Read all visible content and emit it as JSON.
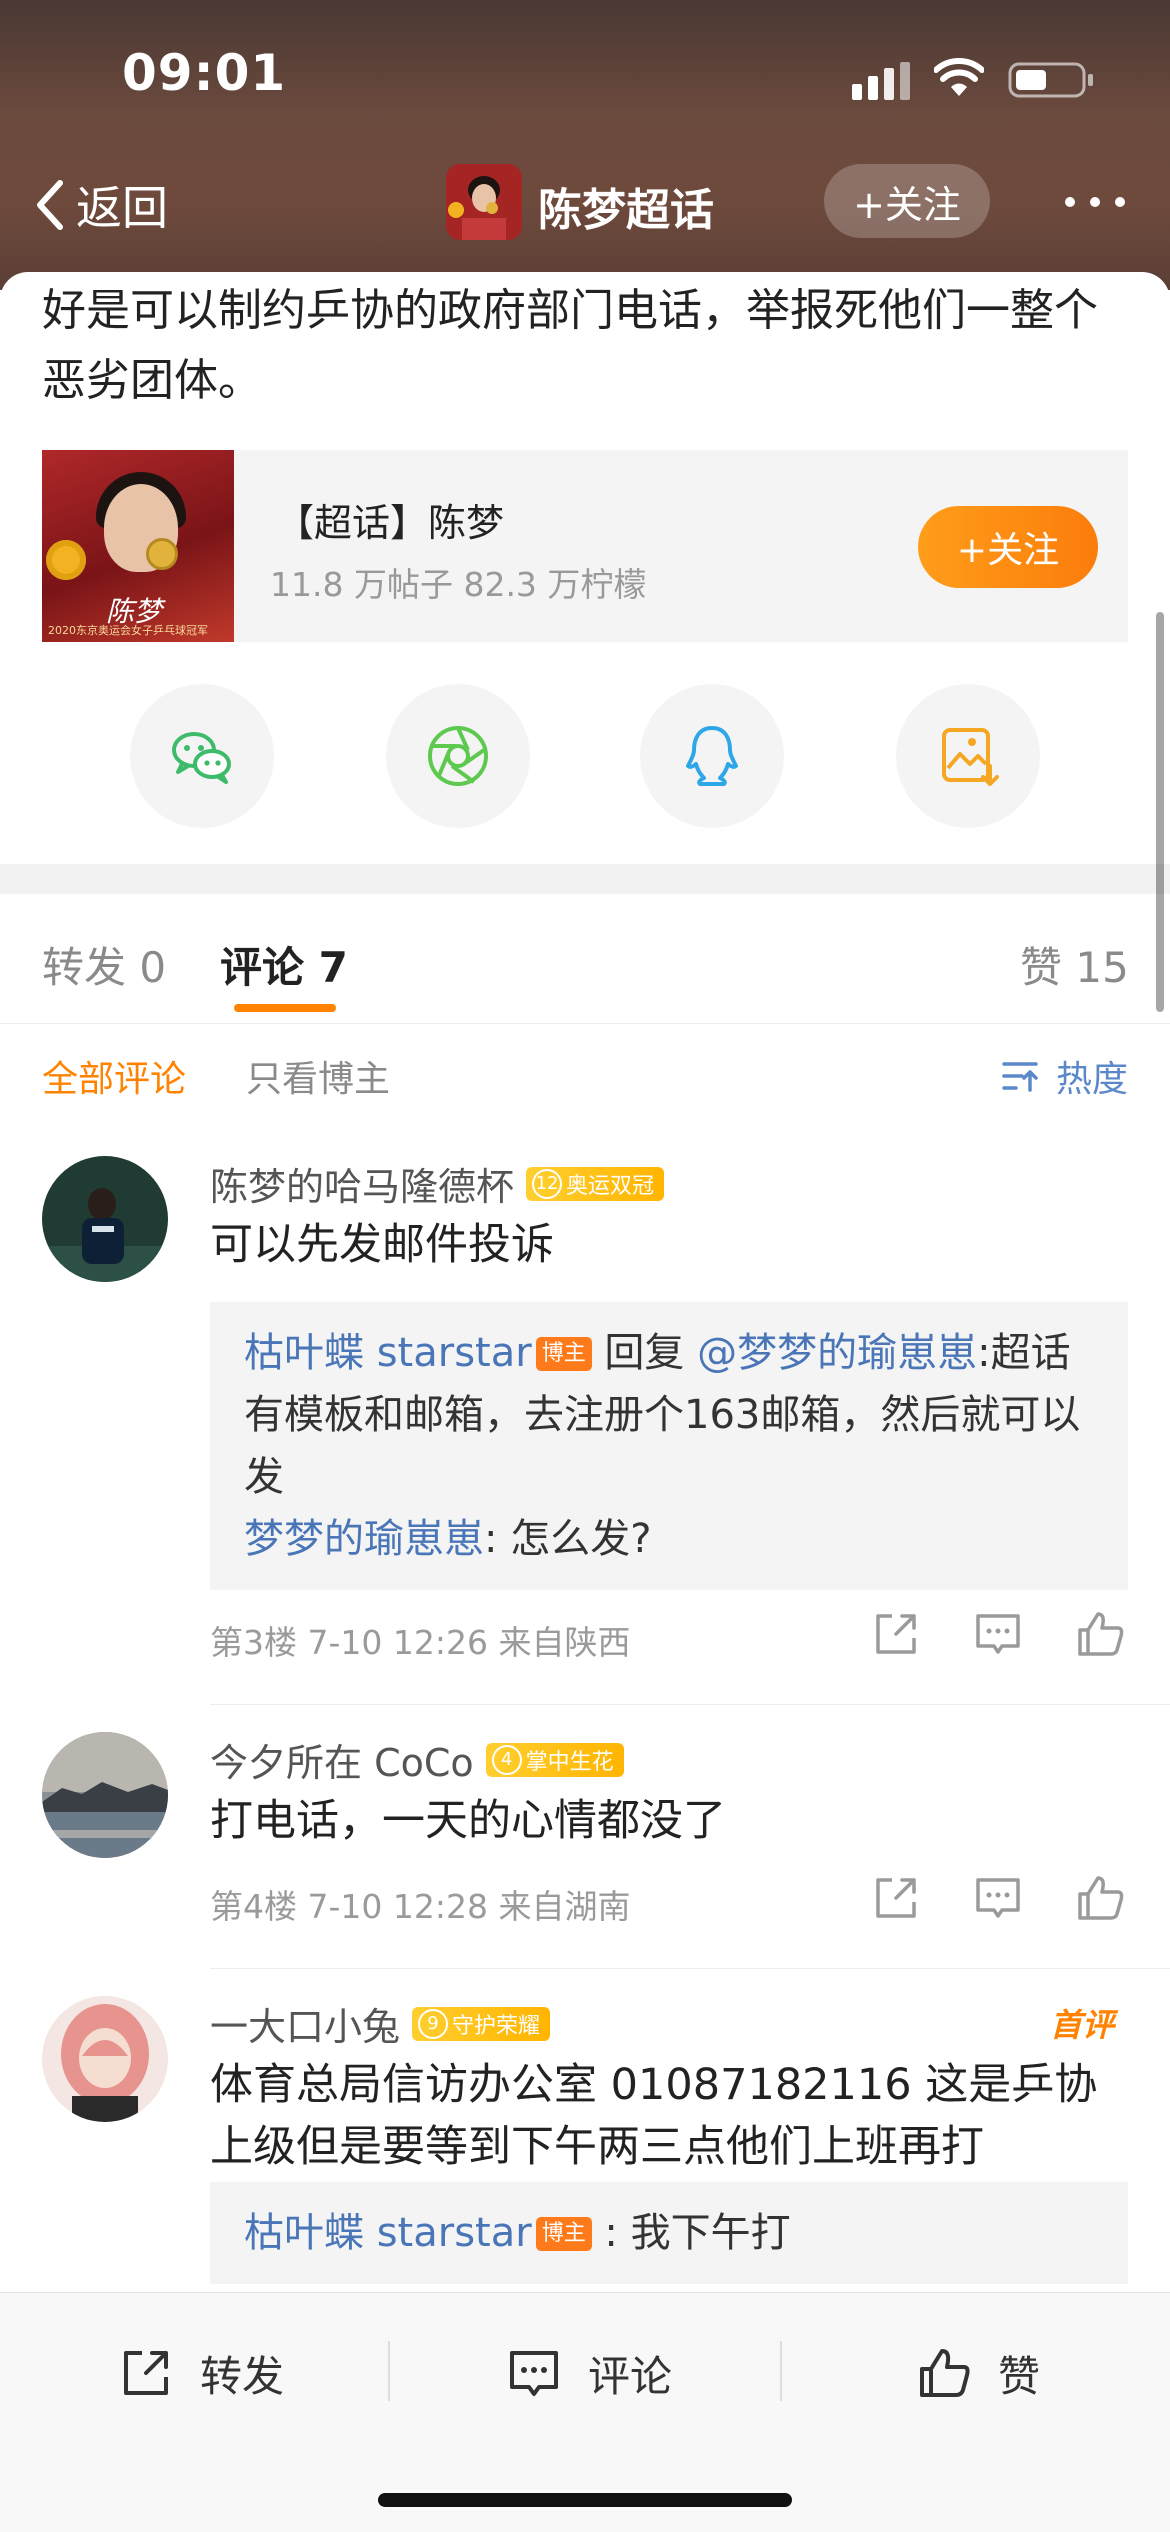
{
  "status_bar": {
    "time": "09:01"
  },
  "nav": {
    "back_label": "返回",
    "title": "陈梦超话",
    "follow_label": "+关注"
  },
  "post": {
    "text": "好是可以制约乒协的政府部门电话，举报死他们一整个恶劣团体。"
  },
  "topic_card": {
    "name": "【超话】陈梦",
    "stats": "11.8 万帖子  82.3 万柠檬",
    "follow_label": "+关注",
    "image_signature": "陈梦",
    "image_caption": "2020东京奥运会女子乒乓球冠军"
  },
  "share": [
    "wechat-icon",
    "moments-icon",
    "qq-icon",
    "save-image-icon"
  ],
  "tabs": {
    "repost": "转发 0",
    "comment": "评论 7",
    "like": "赞 15"
  },
  "filter": {
    "all": "全部评论",
    "owner_only": "只看博主",
    "sort": "热度"
  },
  "comments": [
    {
      "user": "陈梦的哈马隆德杯",
      "badge_level": "12",
      "badge_text": "奥运双冠",
      "text": "可以先发邮件投诉",
      "reply_user": "枯叶蝶 starstar",
      "owner_tag": "博主",
      "reply_word": "回复",
      "reply_target": "@梦梦的瑜崽崽",
      "reply_text": ":超话有模板和邮箱，去注册个163邮箱，然后就可以发",
      "sub_user": "梦梦的瑜崽崽",
      "sub_text": ": 怎么发?",
      "meta": "第3楼  7-10 12:26  来自陕西"
    },
    {
      "user": "今夕所在 CoCo",
      "badge_level": "4",
      "badge_text": "掌中生花",
      "text": "打电话，一天的心情都没了",
      "meta": "第4楼  7-10 12:28  来自湖南"
    },
    {
      "user": "一大口小兔",
      "badge_level": "9",
      "badge_text": "守护荣耀",
      "first_tag": "首评",
      "text": "体育总局信访办公室 01087182116 这是乒协上级但是要等到下午两三点他们上班再打",
      "reply_user": "枯叶蝶 starstar",
      "owner_tag": "博主",
      "reply_text": " : 我下午打"
    }
  ],
  "bottom_bar": {
    "repost": "转发",
    "comment": "评论",
    "like": "赞"
  },
  "colors": {
    "accent": "#ff8200",
    "link": "#4a76b8",
    "header_bg": "#6b4a3e"
  }
}
